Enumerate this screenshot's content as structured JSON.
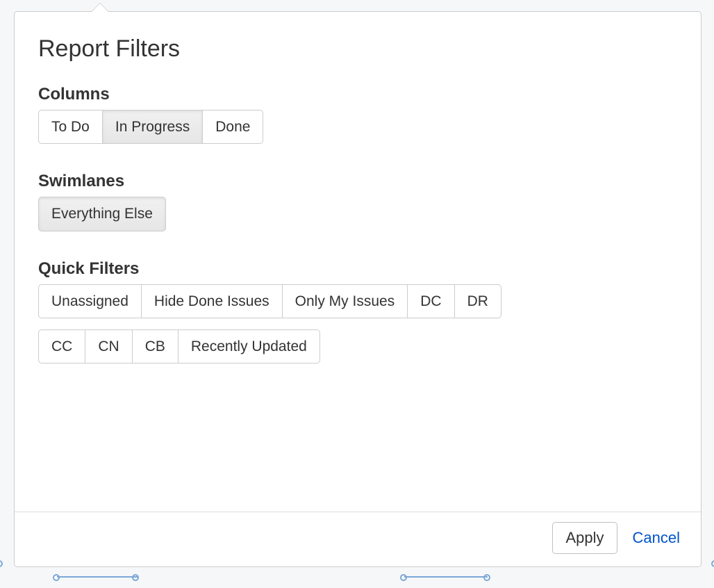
{
  "title": "Report Filters",
  "sections": {
    "columns": {
      "heading": "Columns",
      "options": [
        {
          "label": "To Do",
          "selected": false
        },
        {
          "label": "In Progress",
          "selected": true
        },
        {
          "label": "Done",
          "selected": false
        }
      ]
    },
    "swimlanes": {
      "heading": "Swimlanes",
      "options": [
        {
          "label": "Everything Else",
          "selected": true
        }
      ]
    },
    "quick_filters": {
      "heading": "Quick Filters",
      "row1": [
        {
          "label": "Unassigned",
          "selected": false
        },
        {
          "label": "Hide Done Issues",
          "selected": false
        },
        {
          "label": "Only My Issues",
          "selected": false
        },
        {
          "label": "DC",
          "selected": false
        },
        {
          "label": "DR",
          "selected": false
        }
      ],
      "row2": [
        {
          "label": "CC",
          "selected": false
        },
        {
          "label": "CN",
          "selected": false
        },
        {
          "label": "CB",
          "selected": false
        },
        {
          "label": "Recently Updated",
          "selected": false
        }
      ]
    }
  },
  "footer": {
    "apply_label": "Apply",
    "cancel_label": "Cancel"
  }
}
